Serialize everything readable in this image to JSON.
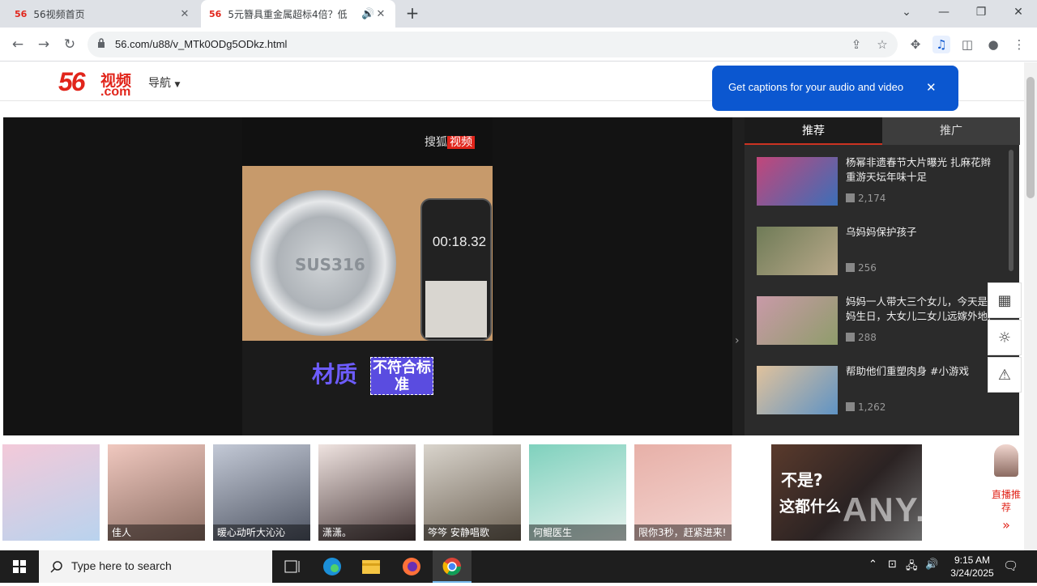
{
  "browser": {
    "tabs": [
      {
        "favicon": "56",
        "title": "56视频首页"
      },
      {
        "favicon": "56",
        "title": "5元簪具重金属超标4倍？低"
      }
    ],
    "url": "56.com/u88/v_MTk0ODg5ODkz.html"
  },
  "site": {
    "logo_num": "56",
    "logo_cn": "视频",
    "logo_domain": ".com",
    "nav_label": "导航"
  },
  "popup": {
    "message": "Get captions for your audio and video"
  },
  "video": {
    "watermark_prefix": "搜狐",
    "watermark_tag": "视频",
    "plate_text": "SUS316",
    "phone_timer": "00:18.32",
    "caption_main": "材质",
    "caption_box": "不符合标准"
  },
  "sidebar": {
    "tabs": [
      "推荐",
      "推广"
    ],
    "items": [
      {
        "title": "杨幂非遗春节大片曝光 扎麻花辫重游天坛年味十足",
        "views": "2,174",
        "color": "#c2467a"
      },
      {
        "title": "乌妈妈保护孩子",
        "views": "256",
        "color": "#6f7b57"
      },
      {
        "title": "妈妈一人带大三个女儿，今天是妈妈生日，大女儿二女儿远嫁外地,",
        "views": "288",
        "color": "#c99aa8"
      },
      {
        "title": "帮助他们重塑肉身 #小游戏",
        "views": "1,262",
        "color": "#5f93c4"
      }
    ]
  },
  "floats": [
    {
      "icon": "qr-code-icon",
      "glyph": "▦"
    },
    {
      "icon": "lightbulb-icon",
      "glyph": "☼"
    },
    {
      "icon": "warning-icon",
      "glyph": "⚠"
    }
  ],
  "strip": {
    "cards": [
      {
        "name": "",
        "color": "#e7b7c9"
      },
      {
        "name": "佳人",
        "color": "#d8a69c"
      },
      {
        "name": "暖心动听大沁沁",
        "color": "#9aa3b3"
      },
      {
        "name": "潇潇。",
        "color": "#c9a8a8"
      },
      {
        "name": "笒笒 安静唱歌",
        "color": "#bcb2a6"
      },
      {
        "name": "何鲲医生",
        "color": "#5eb4a1"
      },
      {
        "name": "限你3秒，赶紧进来!",
        "color": "#d99999"
      }
    ],
    "ad_line1": "不是?",
    "ad_line2": "这都什么",
    "live_label": "直播推荐",
    "live_arrow": "»"
  },
  "watermark": "ANY.RUN",
  "taskbar": {
    "search_placeholder": "Type here to search",
    "time": "9:15 AM",
    "date": "3/24/2025"
  }
}
